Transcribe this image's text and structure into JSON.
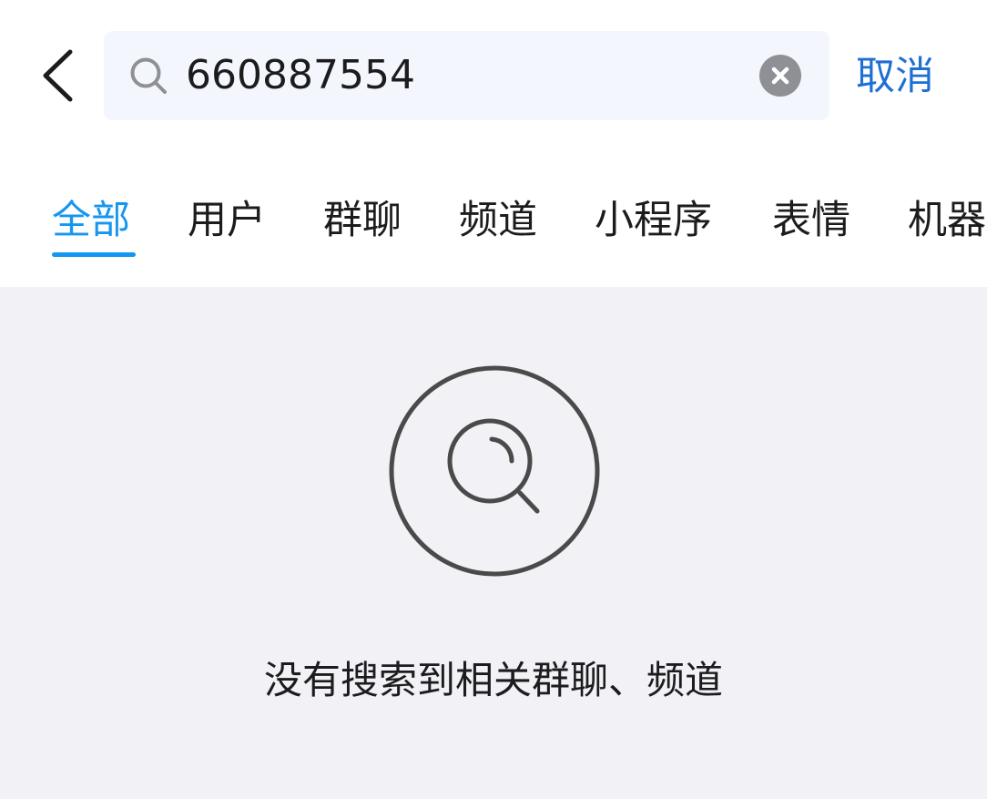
{
  "search": {
    "value": "660887554",
    "cancel_label": "取消"
  },
  "tabs": [
    {
      "label": "全部",
      "active": true
    },
    {
      "label": "用户",
      "active": false
    },
    {
      "label": "群聊",
      "active": false
    },
    {
      "label": "频道",
      "active": false
    },
    {
      "label": "小程序",
      "active": false
    },
    {
      "label": "表情",
      "active": false
    },
    {
      "label": "机器",
      "active": false
    }
  ],
  "empty_state": {
    "message": "没有搜索到相关群聊、频道"
  },
  "colors": {
    "accent": "#1596f0",
    "cancel": "#1e6fd4",
    "content_bg": "#f1f1f6",
    "search_bg": "#f3f6fc"
  },
  "icons": {
    "back": "chevron-left-icon",
    "search": "search-icon",
    "clear": "clear-icon",
    "empty": "empty-search-icon"
  }
}
